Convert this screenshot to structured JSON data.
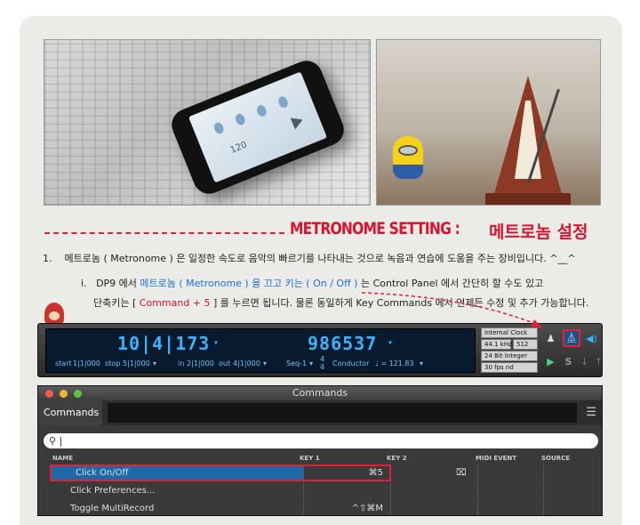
{
  "heading": {
    "english": "METRONOME SETTING :",
    "korean": "메트로놈 설정"
  },
  "step1": {
    "number": "1.",
    "text": "메트로놈 ( Metronome ) 은 일정한 속도로 음악의 빠르기를 나타내는 것으로 녹음과 연습에 도움을 주는 장비입니다. ^__^"
  },
  "step1i": {
    "number": "i.",
    "prefix": "DP9 에서 ",
    "highlight": "메트로놈 ( Metronome ) 을 끄고 키는 ( On / Off )",
    "suffix": " 는 Control Panel 에서 간단히 할 수도 있고"
  },
  "step1i_line2": {
    "prefix": "단축키는 [ ",
    "shortcut": "Command + 5",
    "suffix": " ] 를 누르면 됩니다. 물론 동일하게 Key Commands 에서 언제든 수정 및 추가 가능합니다."
  },
  "phone": {
    "tempo": "120"
  },
  "control_panel": {
    "counter": "10|4|173",
    "samples": "986537",
    "start_label": "start",
    "start_value": "1|1|000",
    "stop_label": "stop",
    "stop_value": "5|1|000",
    "in_label": "in",
    "in_value": "2|1|000",
    "out_label": "out",
    "out_value": "4|1|000",
    "seq": "Seq-1",
    "meter_top": "4",
    "meter_bottom": "4",
    "conductor": "Conductor",
    "tempo": "♩ = 121.83",
    "clock": "Internal Clock",
    "sample_rate": "44.1 kHz",
    "buffer": "512",
    "bit_depth": "24 Bit Integer",
    "frame_rate": "30 fps nd"
  },
  "commands_window": {
    "title": "Commands",
    "tab": "Commands",
    "search_value": "",
    "columns": [
      "NAME",
      "KEY 1",
      "KEY 2",
      "MIDI EVENT",
      "SOURCE"
    ],
    "rows": [
      {
        "name": "Click On/Off",
        "key1": "⌘5",
        "key2": "",
        "selected": true
      },
      {
        "name": "Click Preferences...",
        "key1": "",
        "key2": "",
        "selected": false
      },
      {
        "name": "Toggle MultiRecord",
        "key1": "^⇧⌘M",
        "key2": "",
        "selected": false
      }
    ]
  },
  "colors": {
    "accent_red": "#d8142e",
    "link_blue": "#1f6fd0",
    "lcd_blue": "#3ab4ff"
  }
}
